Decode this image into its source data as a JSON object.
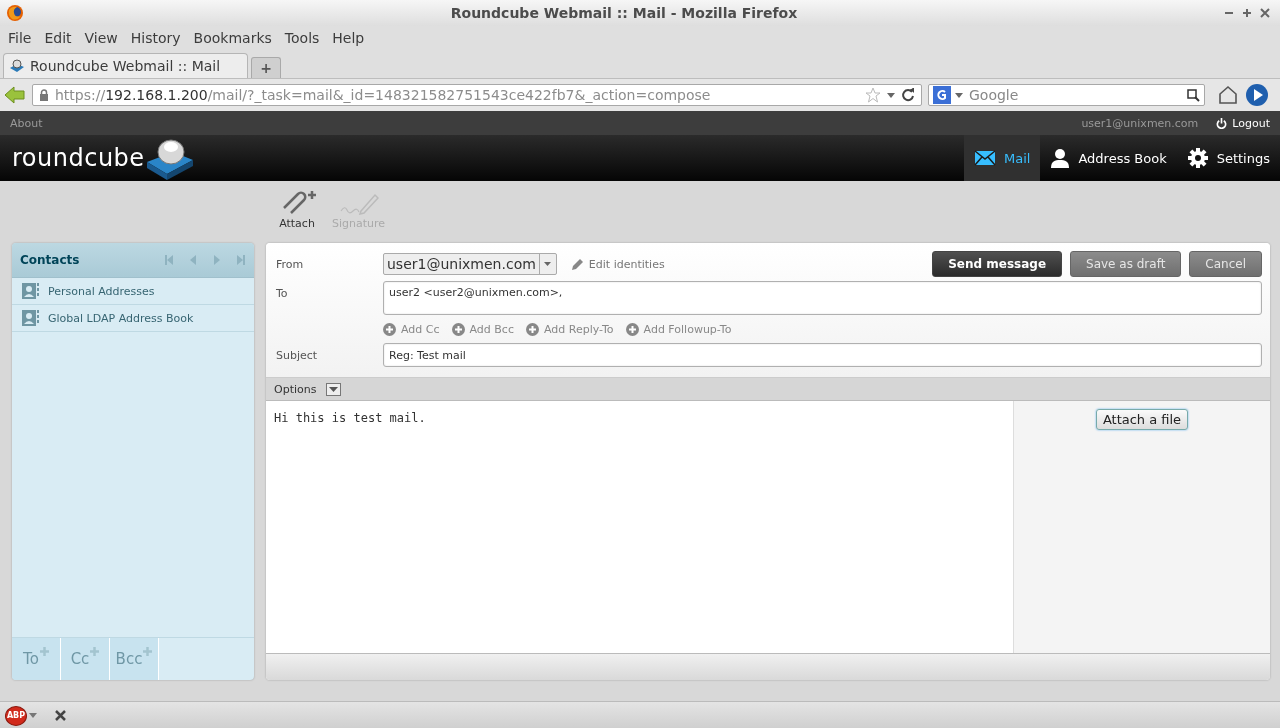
{
  "window": {
    "title": "Roundcube Webmail :: Mail - Mozilla Firefox"
  },
  "menu": [
    "File",
    "Edit",
    "View",
    "History",
    "Bookmarks",
    "Tools",
    "Help"
  ],
  "tabs": [
    {
      "label": "Roundcube Webmail :: Mail",
      "selected": true
    }
  ],
  "new_tab": "+",
  "address_bar": {
    "scheme": "https://",
    "host": "192.168.1.200",
    "path": "/mail/?_task=mail&_id=148321582751543ce422fb7&_action=compose"
  },
  "search": {
    "placeholder": "Google"
  },
  "topline": {
    "about": "About",
    "user": "user1@unixmen.com",
    "logout": "Logout"
  },
  "logo": "roundcube",
  "nav": [
    {
      "label": "Mail",
      "selected": true,
      "kind": "mail"
    },
    {
      "label": "Address Book",
      "selected": false,
      "kind": "contacts"
    },
    {
      "label": "Settings",
      "selected": false,
      "kind": "settings"
    }
  ],
  "toolbar": [
    {
      "label": "Attach",
      "disabled": false,
      "kind": "attach"
    },
    {
      "label": "Signature",
      "disabled": true,
      "kind": "signature"
    }
  ],
  "contacts": {
    "title": "Contacts",
    "items": [
      {
        "label": "Personal Addresses",
        "selected": false
      },
      {
        "label": "Global LDAP Address Book",
        "selected": false
      }
    ],
    "footer_buttons": [
      "To",
      "Cc",
      "Bcc"
    ]
  },
  "compose": {
    "from_label": "From",
    "from": "user1@unixmen.com",
    "edit_identities": "Edit identities",
    "to_label": "To",
    "to": "user2 <user2@unixmen.com>,",
    "add_links": [
      "Add Cc",
      "Add Bcc",
      "Add Reply-To",
      "Add Followup-To"
    ],
    "subject_label": "Subject",
    "subject": "Reg: Test mail",
    "buttons": [
      {
        "label": "Send message",
        "kind": "primary"
      },
      {
        "label": "Save as draft",
        "kind": "secondary"
      },
      {
        "label": "Cancel",
        "kind": "secondary"
      }
    ],
    "options_label": "Options",
    "body": "Hi this is test mail.",
    "attach_button": "Attach a file"
  },
  "status_bar": {
    "addon": "ABP"
  }
}
